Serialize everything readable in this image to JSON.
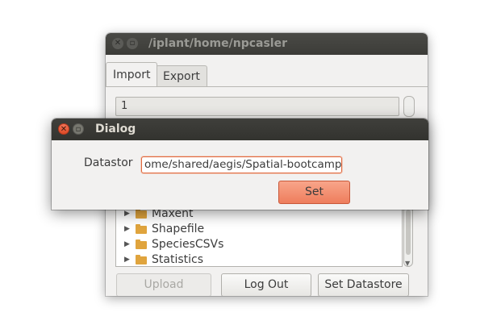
{
  "main_window": {
    "title": "/iplant/home/npcasler",
    "tabs": [
      {
        "label": "Import",
        "active": true
      },
      {
        "label": "Export",
        "active": false
      }
    ],
    "path_value": "1",
    "tree_items": [
      {
        "label": "Maxent"
      },
      {
        "label": "Shapefile"
      },
      {
        "label": "SpeciesCSVs"
      },
      {
        "label": "Statistics"
      }
    ],
    "buttons": {
      "upload": "Upload",
      "logout": "Log Out",
      "set_datastore": "Set Datastore"
    }
  },
  "dialog": {
    "title": "Dialog",
    "datastore_label": "Datastor",
    "datastore_value": "ome/shared/aegis/Spatial-bootcamp",
    "set_button": "Set"
  },
  "colors": {
    "accent": "#ee7d5c",
    "focus_border": "#e0683e",
    "titlebar": "#3c3c38",
    "folder": "#e0a43d"
  }
}
